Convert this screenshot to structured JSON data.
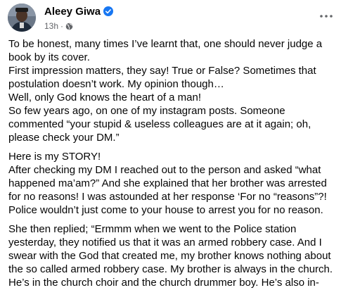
{
  "post": {
    "author": "Aleey Giwa",
    "time": "13h",
    "separator": "·",
    "verified_icon": "verified-badge-icon",
    "privacy_icon": "globe-icon",
    "more_icon": "more-options-icon",
    "colors": {
      "verified": "#1877f2",
      "meta_text": "#65676b",
      "text": "#050505"
    },
    "paragraphs": [
      [
        "To be honest, many times I’ve learnt that, one should never judge a",
        "book by its cover.",
        "First impression matters, they say! True or False? Sometimes that",
        "postulation doesn’t work. My opinion though…",
        "Well, only God knows the heart of a man!",
        "So few years ago, on one of my instagram posts. Someone",
        "commented “your stupid & useless colleagues are at it again; oh,",
        "please check your DM.”"
      ],
      [
        "Here is my STORY!",
        "After checking my DM I reached out to the person and asked “what",
        "happened ma’am?” And she explained that her brother was arrested",
        "for no reasons! I was astounded at her response  ‘For no “reasons”?!",
        "Police wouldn’t just come to your house to arrest you for no reason."
      ],
      [
        "She then replied;  “Ermmm when we went to the Police station",
        "yesterday, they notified us that it was an armed robbery case. And I",
        "swear with the God that created me,  my brother knows nothing about",
        "the so called armed robbery case. My brother is always in the church.",
        "He’s in the church choir and the church drummer boy. He’s  also in-"
      ]
    ]
  }
}
